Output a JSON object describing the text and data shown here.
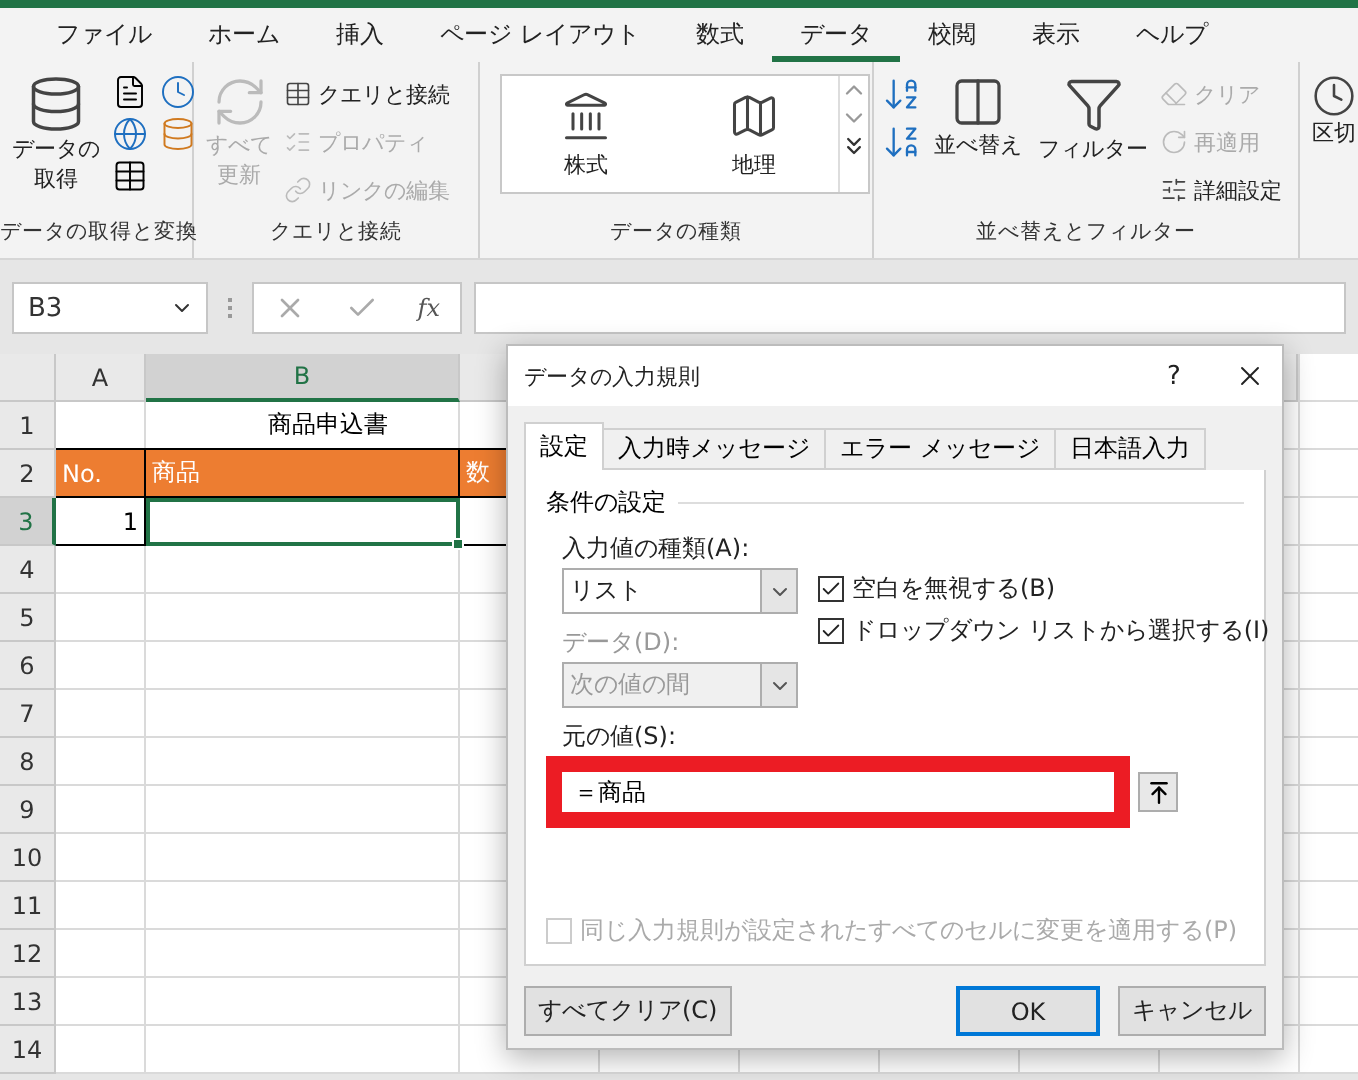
{
  "ribbon": {
    "tabs": [
      {
        "label": "ファイル",
        "selected": false
      },
      {
        "label": "ホーム",
        "selected": false
      },
      {
        "label": "挿入",
        "selected": false
      },
      {
        "label": "ページ レイアウト",
        "selected": false
      },
      {
        "label": "数式",
        "selected": false
      },
      {
        "label": "データ",
        "selected": true
      },
      {
        "label": "校閲",
        "selected": false
      },
      {
        "label": "表示",
        "selected": false
      },
      {
        "label": "ヘルプ",
        "selected": false
      }
    ],
    "groups": [
      {
        "label": "データの取得と変換",
        "items": [
          {
            "kind": "large",
            "lines": [
              "データの",
              "取得"
            ],
            "disabled": false
          }
        ]
      },
      {
        "label": "クエリと接続",
        "items": [
          {
            "kind": "large",
            "lines": [
              "すべて",
              "更新"
            ],
            "disabled": true
          },
          {
            "kind": "small",
            "label": "クエリと接続",
            "disabled": false
          },
          {
            "kind": "small",
            "label": "プロパティ",
            "disabled": true
          },
          {
            "kind": "small",
            "label": "リンクの編集",
            "disabled": true
          }
        ]
      },
      {
        "label": "データの種類",
        "items": [
          {
            "kind": "gallery",
            "label": "株式",
            "disabled": false
          },
          {
            "kind": "gallery",
            "label": "地理",
            "disabled": false
          }
        ]
      },
      {
        "label": "並べ替えとフィルター",
        "items": [
          {
            "kind": "large",
            "lines": [
              "並べ替え"
            ],
            "disabled": false
          },
          {
            "kind": "large",
            "lines": [
              "フィルター"
            ],
            "disabled": false
          },
          {
            "kind": "small",
            "label": "クリア",
            "disabled": true
          },
          {
            "kind": "small",
            "label": "再適用",
            "disabled": true
          },
          {
            "kind": "small",
            "label": "詳細設定",
            "disabled": false
          }
        ]
      },
      {
        "items": [
          {
            "kind": "large",
            "lines": [
              "区切"
            ],
            "disabled": false
          }
        ]
      }
    ]
  },
  "formula_bar": {
    "name_box": "B3",
    "function_label": "fx"
  },
  "sheet": {
    "columns": [
      {
        "label": "A",
        "selected": false
      },
      {
        "label": "B",
        "selected": true
      }
    ],
    "rows": [
      {
        "number": "1",
        "selected": false,
        "title": "商品申込書"
      },
      {
        "number": "2",
        "selected": false,
        "header": [
          "No.",
          "商品",
          "数"
        ]
      },
      {
        "number": "3",
        "selected": true,
        "cells": [
          "1"
        ]
      },
      {
        "number": "4",
        "selected": false
      },
      {
        "number": "5",
        "selected": false
      },
      {
        "number": "6",
        "selected": false
      },
      {
        "number": "7",
        "selected": false
      },
      {
        "number": "8",
        "selected": false
      },
      {
        "number": "9",
        "selected": false
      },
      {
        "number": "10",
        "selected": false
      },
      {
        "number": "11",
        "selected": false
      },
      {
        "number": "12",
        "selected": false
      },
      {
        "number": "13",
        "selected": false
      },
      {
        "number": "14",
        "selected": false
      }
    ]
  },
  "dialog": {
    "title": "データの入力規則",
    "help": "?",
    "tabs": [
      {
        "label": "設定",
        "selected": true
      },
      {
        "label": "入力時メッセージ",
        "selected": false
      },
      {
        "label": "エラー メッセージ",
        "selected": false
      },
      {
        "label": "日本語入力",
        "selected": false
      }
    ],
    "section": "条件の設定",
    "type_label": "入力値の種類(A):",
    "type_value": "リスト",
    "checkboxes": [
      {
        "label": "空白を無視する(B)",
        "checked": true
      },
      {
        "label": "ドロップダウン リストから選択する(I)",
        "checked": true
      }
    ],
    "data_label": "データ(D):",
    "data_value": "次の値の間",
    "data_disabled": true,
    "source_label": "元の値(S):",
    "source_value": "＝商品",
    "source_highlighted": true,
    "apply_all": {
      "label": "同じ入力規則が設定されたすべてのセルに変更を適用する(P)",
      "checked": false,
      "disabled": true
    },
    "buttons": [
      {
        "label": "すべてクリア(C)",
        "default": false
      },
      {
        "label": "OK",
        "default": true
      },
      {
        "label": "キャンセル",
        "default": false
      }
    ]
  }
}
